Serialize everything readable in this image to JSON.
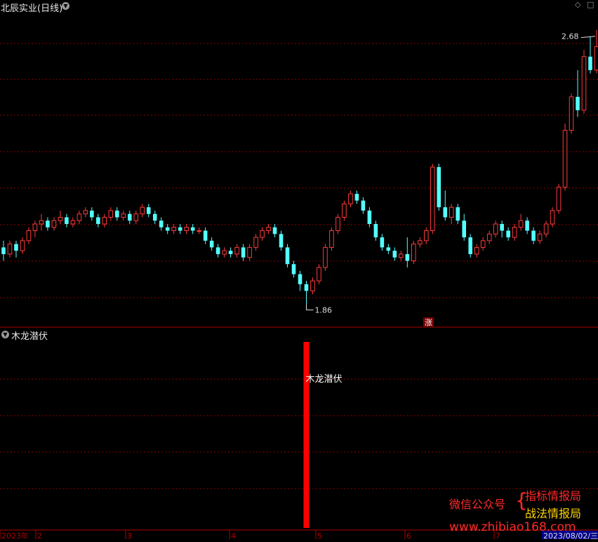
{
  "main_panel": {
    "title": "北辰实业(日线)",
    "high_label": "2.68",
    "low_label": "1.86",
    "rise_badge": "涨"
  },
  "sub_panel": {
    "title": "木龙潜伏",
    "signal_label": "木龙潜伏"
  },
  "x_axis": {
    "labels": [
      "2023年",
      "2",
      "3",
      "4",
      "5",
      "6",
      "7"
    ],
    "current_date": "2023/08/02/三"
  },
  "watermark": {
    "left": "微信公众号",
    "brace": "{",
    "line1": "指标情报局",
    "line2": "战法情报局",
    "url": "www.zhibiao168.com"
  },
  "colors": {
    "up": "#ff3b3b",
    "down": "#54ffff",
    "grid": "#8b0000",
    "signal": "#ff0000",
    "watermark_red": "#ff2a2a",
    "watermark_yellow": "#ffd400"
  },
  "chart_data": {
    "type": "candlestick",
    "y_range": [
      1.8,
      2.74
    ],
    "low_point": 1.86,
    "high_point": 2.68,
    "candles": [
      [
        2.03,
        2.01,
        2.05,
        1.99
      ],
      [
        2.01,
        2.04,
        2.05,
        2.0
      ],
      [
        2.04,
        2.02,
        2.05,
        2.0
      ],
      [
        2.02,
        2.05,
        2.06,
        2.01
      ],
      [
        2.05,
        2.08,
        2.09,
        2.04
      ],
      [
        2.08,
        2.1,
        2.11,
        2.06
      ],
      [
        2.1,
        2.11,
        2.13,
        2.08
      ],
      [
        2.11,
        2.09,
        2.12,
        2.08
      ],
      [
        2.09,
        2.11,
        2.12,
        2.08
      ],
      [
        2.11,
        2.12,
        2.14,
        2.1
      ],
      [
        2.12,
        2.1,
        2.13,
        2.09
      ],
      [
        2.1,
        2.11,
        2.12,
        2.09
      ],
      [
        2.11,
        2.13,
        2.14,
        2.1
      ],
      [
        2.13,
        2.14,
        2.15,
        2.12
      ],
      [
        2.14,
        2.12,
        2.15,
        2.11
      ],
      [
        2.12,
        2.1,
        2.13,
        2.09
      ],
      [
        2.1,
        2.12,
        2.13,
        2.09
      ],
      [
        2.12,
        2.14,
        2.15,
        2.11
      ],
      [
        2.14,
        2.12,
        2.15,
        2.11
      ],
      [
        2.12,
        2.13,
        2.14,
        2.11
      ],
      [
        2.13,
        2.11,
        2.14,
        2.1
      ],
      [
        2.11,
        2.13,
        2.14,
        2.1
      ],
      [
        2.13,
        2.15,
        2.16,
        2.12
      ],
      [
        2.15,
        2.13,
        2.16,
        2.12
      ],
      [
        2.13,
        2.11,
        2.14,
        2.1
      ],
      [
        2.11,
        2.09,
        2.12,
        2.08
      ],
      [
        2.09,
        2.08,
        2.1,
        2.07
      ],
      [
        2.08,
        2.09,
        2.1,
        2.07
      ],
      [
        2.09,
        2.08,
        2.1,
        2.07
      ],
      [
        2.08,
        2.09,
        2.1,
        2.07
      ],
      [
        2.09,
        2.08,
        2.1,
        2.07
      ],
      [
        2.08,
        2.08,
        2.09,
        2.07
      ],
      [
        2.08,
        2.05,
        2.09,
        2.04
      ],
      [
        2.05,
        2.03,
        2.06,
        2.02
      ],
      [
        2.03,
        2.01,
        2.04,
        2.0
      ],
      [
        2.01,
        2.02,
        2.03,
        2.0
      ],
      [
        2.02,
        2.01,
        2.03,
        2.0
      ],
      [
        2.01,
        2.03,
        2.04,
        2.0
      ],
      [
        2.03,
        2.0,
        2.04,
        1.99
      ],
      [
        2.0,
        2.03,
        2.04,
        1.99
      ],
      [
        2.03,
        2.06,
        2.07,
        2.02
      ],
      [
        2.06,
        2.08,
        2.09,
        2.05
      ],
      [
        2.08,
        2.09,
        2.1,
        2.07
      ],
      [
        2.09,
        2.07,
        2.1,
        2.06
      ],
      [
        2.07,
        2.03,
        2.08,
        2.02
      ],
      [
        2.03,
        1.98,
        2.04,
        1.97
      ],
      [
        1.98,
        1.95,
        1.99,
        1.94
      ],
      [
        1.95,
        1.92,
        1.96,
        1.9
      ],
      [
        1.92,
        1.9,
        1.93,
        1.86
      ],
      [
        1.9,
        1.93,
        1.94,
        1.89
      ],
      [
        1.93,
        1.97,
        1.98,
        1.92
      ],
      [
        1.97,
        2.03,
        2.04,
        1.96
      ],
      [
        2.03,
        2.08,
        2.09,
        2.02
      ],
      [
        2.08,
        2.12,
        2.13,
        2.07
      ],
      [
        2.12,
        2.16,
        2.17,
        2.11
      ],
      [
        2.16,
        2.19,
        2.2,
        2.15
      ],
      [
        2.19,
        2.17,
        2.2,
        2.16
      ],
      [
        2.17,
        2.14,
        2.18,
        2.13
      ],
      [
        2.14,
        2.1,
        2.15,
        2.09
      ],
      [
        2.1,
        2.06,
        2.11,
        2.05
      ],
      [
        2.06,
        2.03,
        2.07,
        2.02
      ],
      [
        2.03,
        2.02,
        2.04,
        2.01
      ],
      [
        2.02,
        2.0,
        2.03,
        1.99
      ],
      [
        2.0,
        2.01,
        2.02,
        1.99
      ],
      [
        2.01,
        1.99,
        2.06,
        1.97
      ],
      [
        1.99,
        2.04,
        2.05,
        1.98
      ],
      [
        2.04,
        2.05,
        2.06,
        2.03
      ],
      [
        2.05,
        2.08,
        2.09,
        2.04
      ],
      [
        2.08,
        2.27,
        2.28,
        2.07
      ],
      [
        2.27,
        2.15,
        2.28,
        2.14
      ],
      [
        2.15,
        2.12,
        2.2,
        2.11
      ],
      [
        2.12,
        2.15,
        2.16,
        2.1
      ],
      [
        2.15,
        2.11,
        2.16,
        2.1
      ],
      [
        2.11,
        2.06,
        2.13,
        2.05
      ],
      [
        2.06,
        2.01,
        2.07,
        2.0
      ],
      [
        2.01,
        2.03,
        2.04,
        2.0
      ],
      [
        2.03,
        2.05,
        2.06,
        2.02
      ],
      [
        2.05,
        2.07,
        2.08,
        2.04
      ],
      [
        2.07,
        2.1,
        2.11,
        2.06
      ],
      [
        2.1,
        2.08,
        2.11,
        2.06
      ],
      [
        2.08,
        2.06,
        2.09,
        2.05
      ],
      [
        2.06,
        2.09,
        2.1,
        2.05
      ],
      [
        2.09,
        2.11,
        2.13,
        2.08
      ],
      [
        2.11,
        2.08,
        2.12,
        2.07
      ],
      [
        2.08,
        2.05,
        2.09,
        2.04
      ],
      [
        2.05,
        2.07,
        2.08,
        2.04
      ],
      [
        2.07,
        2.1,
        2.11,
        2.06
      ],
      [
        2.1,
        2.14,
        2.15,
        2.09
      ],
      [
        2.14,
        2.21,
        2.22,
        2.13
      ],
      [
        2.21,
        2.38,
        2.4,
        2.2
      ],
      [
        2.38,
        2.48,
        2.49,
        2.37
      ],
      [
        2.48,
        2.44,
        2.56,
        2.42
      ],
      [
        2.44,
        2.6,
        2.62,
        2.43
      ],
      [
        2.6,
        2.56,
        2.66,
        2.55
      ],
      [
        2.56,
        2.63,
        2.68,
        2.55
      ]
    ],
    "indicator": {
      "name": "木龙潜伏",
      "signal_bars": [
        48
      ]
    }
  }
}
